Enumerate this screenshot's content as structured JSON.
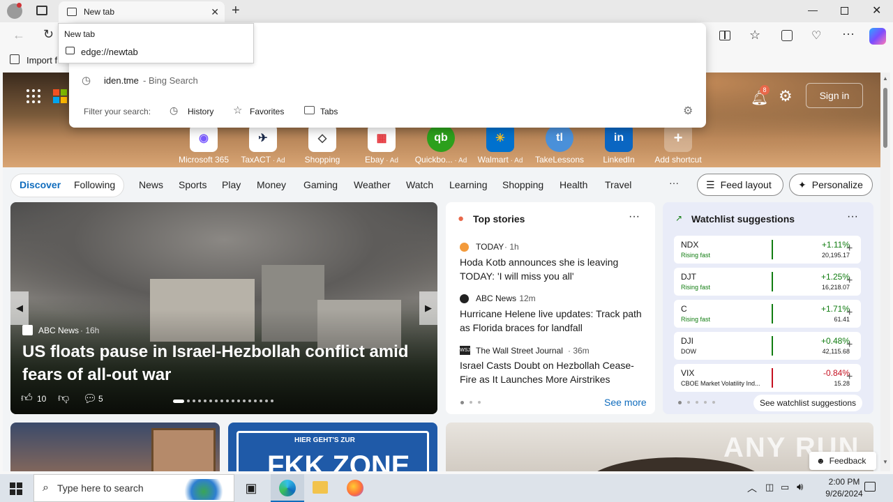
{
  "browser": {
    "tab_title": "New tab",
    "tooltip": {
      "title": "New tab",
      "url": "edge://newtab"
    },
    "favorites_bar_item": "Import f"
  },
  "omnibox_dropdown": {
    "suggestion": {
      "query": "iden.tme",
      "source": " - Bing Search"
    },
    "filter_label": "Filter your search:",
    "filters": [
      "History",
      "Favorites",
      "Tabs"
    ]
  },
  "page": {
    "notification_count": "8",
    "sign_in": "Sign in",
    "shortcuts": [
      {
        "label": "Microsoft 365",
        "ad": ""
      },
      {
        "label": "TaxACT",
        "ad": " · Ad"
      },
      {
        "label": "Shopping",
        "ad": ""
      },
      {
        "label": "Ebay",
        "ad": " · Ad"
      },
      {
        "label": "Quickbo...",
        "ad": " · Ad"
      },
      {
        "label": "Walmart",
        "ad": " · Ad"
      },
      {
        "label": "TakeLessons",
        "ad": ""
      },
      {
        "label": "LinkedIn",
        "ad": ""
      },
      {
        "label": "Add shortcut",
        "ad": ""
      }
    ],
    "nav": {
      "discover": "Discover",
      "following": "Following",
      "items": [
        "News",
        "Sports",
        "Play",
        "Money",
        "Gaming",
        "Weather",
        "Watch",
        "Learning",
        "Shopping",
        "Health",
        "Travel"
      ],
      "more": "···",
      "feed_layout": "Feed layout",
      "personalize": "Personalize"
    },
    "feature": {
      "source": "ABC News",
      "age": " · 16h",
      "headline": "US floats pause in Israel-Hezbollah conflict amid fears of all-out war",
      "likes": "10",
      "comments": "5"
    },
    "top_stories": {
      "title": "Top stories",
      "items": [
        {
          "source": "TODAY",
          "age": " · 1h",
          "headline": "Hoda Kotb announces she is leaving TODAY: 'I will miss you all'"
        },
        {
          "source": "ABC News",
          "age": " · 12m",
          "headline": "Hurricane Helene live updates: Track path as Florida braces for landfall"
        },
        {
          "source": "The Wall Street Journal",
          "age": " · 36m",
          "headline": "Israel Casts Doubt on Hezbollah Cease-Fire as It Launches More Airstrikes"
        }
      ],
      "see_more": "See more"
    },
    "watchlist": {
      "title": "Watchlist suggestions",
      "rows": [
        {
          "symbol": "NDX",
          "sub": "Rising fast",
          "change": "+1.11%",
          "price": "20,195.17",
          "up": true
        },
        {
          "symbol": "DJT",
          "sub": "Rising fast",
          "change": "+1.25%",
          "price": "16,218.07",
          "up": true
        },
        {
          "symbol": "C",
          "sub": "Rising fast",
          "change": "+1.71%",
          "price": "61.41",
          "up": true
        },
        {
          "symbol": "DJI",
          "sub": "DOW",
          "change": "+0.48%",
          "price": "42,115.68",
          "up": true
        },
        {
          "symbol": "VIX",
          "sub": "CBOE Market Volatility Ind...",
          "change": "-0.84%",
          "price": "15.28",
          "up": false
        }
      ],
      "see_watchlist": "See watchlist suggestions"
    },
    "bottom_card_banner": "HIER GEHT'S ZUR",
    "bottom_card_big": "FKK ZONE",
    "feedback": "Feedback",
    "watermark": "ANY RUN"
  },
  "taskbar": {
    "search_placeholder": "Type here to search",
    "time": "2:00 PM",
    "date": "9/26/2024"
  },
  "colors": {
    "accent": "#0f6cbd",
    "up": "#107c10",
    "down": "#c50f1f"
  }
}
